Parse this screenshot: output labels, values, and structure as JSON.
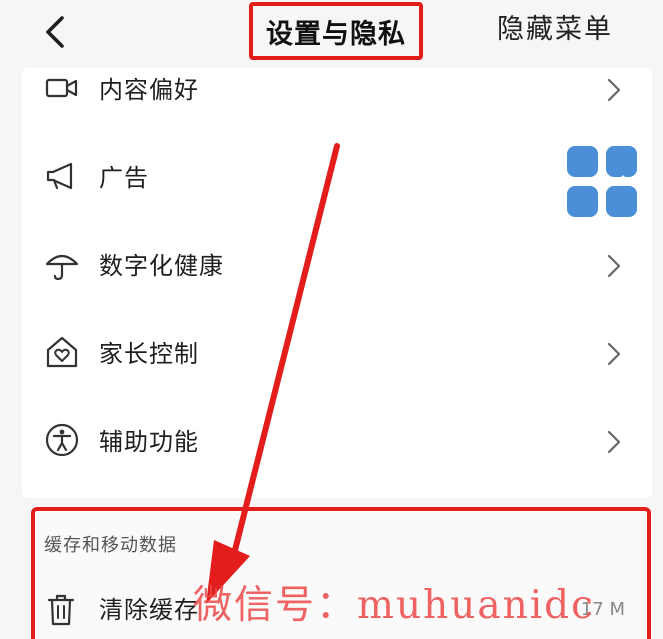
{
  "header": {
    "back_icon": "chevron-left-icon",
    "title": "设置与隐私",
    "right_label": "隐藏菜单"
  },
  "settings": {
    "items": [
      {
        "label": "内容偏好",
        "icon": "video-camera-icon",
        "has_chevron": true
      },
      {
        "label": "广告",
        "icon": "megaphone-icon",
        "has_chevron": false
      },
      {
        "label": "数字化健康",
        "icon": "umbrella-icon",
        "has_chevron": true
      },
      {
        "label": "家长控制",
        "icon": "home-heart-icon",
        "has_chevron": true
      },
      {
        "label": "辅助功能",
        "icon": "accessibility-icon",
        "has_chevron": true
      }
    ]
  },
  "cache": {
    "section_title": "缓存和移动数据",
    "clear_label": "清除缓存",
    "size": "17 M",
    "clear_icon": "trash-icon"
  },
  "overlay": {
    "watermark": "微信号：muhuanidc",
    "annotation_color": "#e31c1c",
    "grid_icon_color": "#4a8fd8"
  }
}
